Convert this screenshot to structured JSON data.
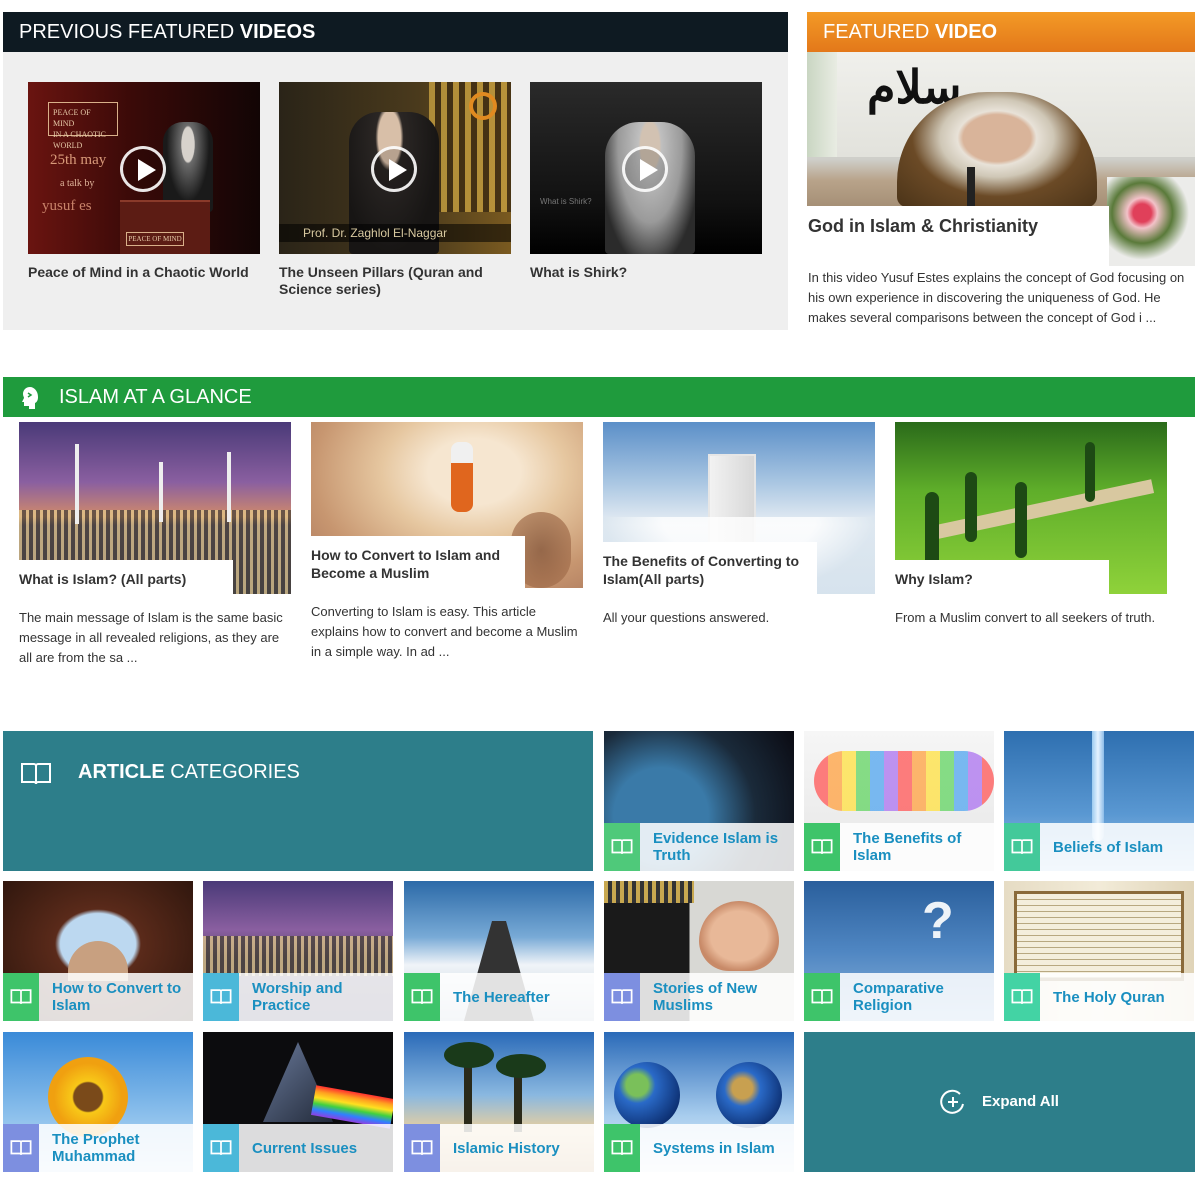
{
  "prev_videos": {
    "heading_normal": "PREVIOUS FEATURED ",
    "heading_bold": "VIDEOS",
    "items": [
      {
        "title": "Peace of Mind in a Chaotic World",
        "overlay": [
          "PEACE OF MIND",
          "IN A CHAOTIC WORLD",
          "25th may",
          "a talk by",
          "yusuf es",
          "PEACE OF MIND"
        ]
      },
      {
        "title": "The Unseen Pillars (Quran and Science series)",
        "overlay": [
          "Prof. Dr. Zaghlol El-Naggar"
        ]
      },
      {
        "title": "What is Shirk?",
        "overlay": [
          "What is Shirk?"
        ]
      }
    ]
  },
  "featured": {
    "heading_normal": "FEATURED ",
    "heading_bold": "VIDEO",
    "title": "God in Islam & Christianity",
    "description": "In this video Yusuf Estes explains the concept of God focusing on his own experience in discovering the uniqueness of God. He makes several comparisons between the concept of God i ...",
    "banner_text": "سلام"
  },
  "glance": {
    "heading": "ISLAM AT A GLANCE",
    "items": [
      {
        "title": "What is Islam? (All parts)",
        "desc": "The main message of Islam is the same basic message in all revealed religions, as they are all are from the sa ..."
      },
      {
        "title": "How to Convert to Islam and Become a Muslim",
        "desc": "Converting to Islam is easy.  This article explains how to convert and become a Muslim in a simple way.  In ad ..."
      },
      {
        "title": "The Benefits of Converting to Islam(All parts)",
        "desc": "All your questions answered."
      },
      {
        "title": "Why Islam?",
        "desc": "From a Muslim convert to all seekers of truth."
      }
    ]
  },
  "categories": {
    "heading_bold": "ARTICLE",
    "heading_normal": " CATEGORIES",
    "tiles": [
      {
        "label": "Evidence Islam is Truth",
        "accent": "#4fc97a"
      },
      {
        "label": "The Benefits of Islam",
        "accent": "#3ec46a"
      },
      {
        "label": "Beliefs of Islam",
        "accent": "#43c99a"
      },
      {
        "label": "How to Convert to Islam",
        "accent": "#3ec46a"
      },
      {
        "label": "Worship and Practice",
        "accent": "#4bb8d9"
      },
      {
        "label": "The Hereafter",
        "accent": "#3ec46a"
      },
      {
        "label": "Stories of New Muslims",
        "accent": "#7d8fe0"
      },
      {
        "label": "Comparative Religion",
        "accent": "#3ec46a"
      },
      {
        "label": "The Holy Quran",
        "accent": "#43d3a4"
      },
      {
        "label": "The Prophet Muhammad",
        "accent": "#7d8fe0"
      },
      {
        "label": "Current Issues",
        "accent": "#4bb8d9"
      },
      {
        "label": "Islamic History",
        "accent": "#7d8fe0"
      },
      {
        "label": "Systems in Islam",
        "accent": "#3ec46a"
      }
    ],
    "expand_label": "Expand All"
  }
}
